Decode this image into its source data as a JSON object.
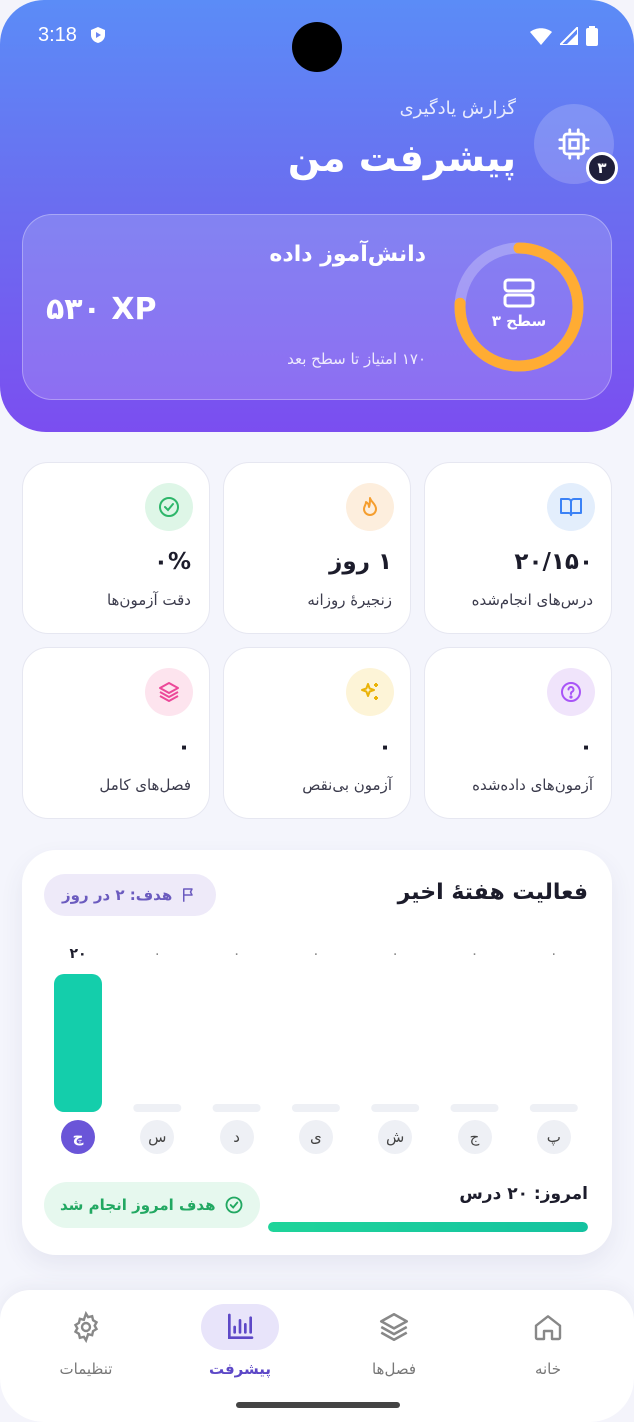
{
  "status_bar": {
    "time": "3:18"
  },
  "header": {
    "subtitle": "گزارش یادگیری",
    "title": "پیشرفت من",
    "avatar_badge": "۳"
  },
  "xp": {
    "rank_title": "دانش‌آموز داده",
    "xp_value": "۵۳۰ XP",
    "next_level_text": "۱۷۰ امتیاز تا سطح بعد",
    "level_label": "سطح ۳",
    "progress_fraction": 0.76,
    "colors": {
      "ring": "#ffac33",
      "track": "rgba(255,255,255,0.25)"
    }
  },
  "stats": [
    {
      "value": "۲۰/۱۵۰",
      "label": "درس‌های انجام‌شده",
      "icon": "book-icon",
      "icon_bg": "#e3eefc",
      "icon_color": "#3b82f6"
    },
    {
      "value": "۱ روز",
      "label": "زنجیرهٔ روزانه",
      "icon": "flame-icon",
      "icon_bg": "#fdeedd",
      "icon_color": "#f59e2f"
    },
    {
      "value": "۰%",
      "label": "دقت آزمون‌ها",
      "icon": "check-circle-icon",
      "icon_bg": "#def6e7",
      "icon_color": "#2eb66a"
    },
    {
      "value": "۰",
      "label": "آزمون‌های داده‌شده",
      "icon": "question-circle-icon",
      "icon_bg": "#f0e4fb",
      "icon_color": "#a855f7"
    },
    {
      "value": "۰",
      "label": "آزمون بی‌نقص",
      "icon": "sparkles-icon",
      "icon_bg": "#fdf4d7",
      "icon_color": "#eab308"
    },
    {
      "value": "۰",
      "label": "فصل‌های کامل",
      "icon": "layers-icon",
      "icon_bg": "#fde4ee",
      "icon_color": "#ec4899"
    }
  ],
  "activity": {
    "title": "فعالیت هفتهٔ اخیر",
    "goal_label": "هدف: ۲ در روز",
    "today_text": "امروز: ۲۰ درس",
    "today_progress": 1.0,
    "done_label": "هدف امروز انجام شد",
    "colors": {
      "bar": "#14ceab",
      "empty": "#eef0f5",
      "active_day": "#6a55d8"
    }
  },
  "chart_data": {
    "type": "bar",
    "categories": [
      "چ",
      "س",
      "د",
      "ی",
      "ش",
      "ج",
      "پ"
    ],
    "values": [
      20,
      0,
      0,
      0,
      0,
      0,
      0
    ],
    "data_labels": [
      "۲۰",
      "۰",
      "۰",
      "۰",
      "۰",
      "۰",
      "۰"
    ],
    "title": "فعالیت هفتهٔ اخیر",
    "active_category": "چ"
  },
  "nav": {
    "items": [
      {
        "label": "خانه",
        "icon": "home-icon"
      },
      {
        "label": "فصل‌ها",
        "icon": "layers-icon"
      },
      {
        "label": "پیشرفت",
        "icon": "bar-chart-icon"
      },
      {
        "label": "تنظیمات",
        "icon": "gear-icon"
      }
    ],
    "active": "پیشرفت"
  }
}
